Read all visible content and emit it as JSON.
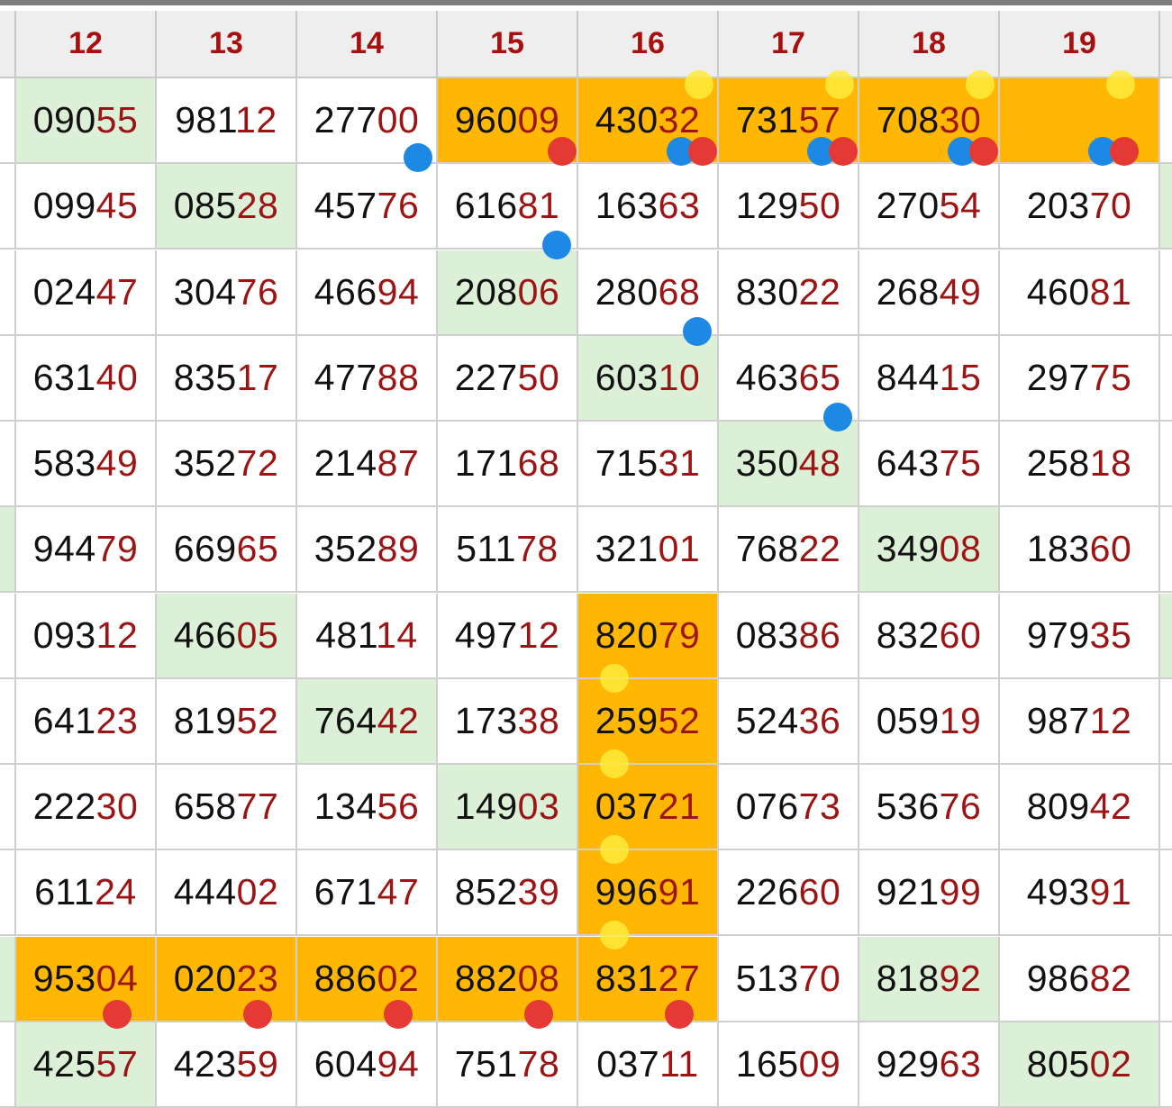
{
  "columns": [
    "12",
    "13",
    "14",
    "15",
    "16",
    "17",
    "18",
    "19"
  ],
  "rows": [
    {
      "cells": [
        [
          "090",
          "55",
          "green"
        ],
        [
          "981",
          "12",
          ""
        ],
        [
          "277",
          "00",
          ""
        ],
        [
          "960",
          "09",
          "orange"
        ],
        [
          "430",
          "32",
          "orange"
        ],
        [
          "731",
          "57",
          "orange"
        ],
        [
          "708",
          "30",
          "orange"
        ],
        [
          "",
          "",
          "orange"
        ]
      ]
    },
    {
      "cells": [
        [
          "099",
          "45",
          ""
        ],
        [
          "085",
          "28",
          "green"
        ],
        [
          "457",
          "76",
          ""
        ],
        [
          "616",
          "81",
          ""
        ],
        [
          "163",
          "63",
          ""
        ],
        [
          "129",
          "50",
          ""
        ],
        [
          "270",
          "54",
          ""
        ],
        [
          "203",
          "70",
          ""
        ]
      ]
    },
    {
      "cells": [
        [
          "024",
          "47",
          ""
        ],
        [
          "304",
          "76",
          ""
        ],
        [
          "466",
          "94",
          ""
        ],
        [
          "208",
          "06",
          "green"
        ],
        [
          "280",
          "68",
          ""
        ],
        [
          "830",
          "22",
          ""
        ],
        [
          "268",
          "49",
          ""
        ],
        [
          "460",
          "81",
          ""
        ]
      ]
    },
    {
      "cells": [
        [
          "631",
          "40",
          ""
        ],
        [
          "835",
          "17",
          ""
        ],
        [
          "477",
          "88",
          ""
        ],
        [
          "227",
          "50",
          ""
        ],
        [
          "603",
          "10",
          "green"
        ],
        [
          "463",
          "65",
          ""
        ],
        [
          "844",
          "15",
          ""
        ],
        [
          "297",
          "75",
          ""
        ]
      ]
    },
    {
      "cells": [
        [
          "583",
          "49",
          ""
        ],
        [
          "352",
          "72",
          ""
        ],
        [
          "214",
          "87",
          ""
        ],
        [
          "171",
          "68",
          ""
        ],
        [
          "715",
          "31",
          ""
        ],
        [
          "350",
          "48",
          "green"
        ],
        [
          "643",
          "75",
          ""
        ],
        [
          "258",
          "18",
          ""
        ]
      ]
    },
    {
      "cells": [
        [
          "944",
          "79",
          ""
        ],
        [
          "669",
          "65",
          ""
        ],
        [
          "352",
          "89",
          ""
        ],
        [
          "511",
          "78",
          ""
        ],
        [
          "321",
          "01",
          ""
        ],
        [
          "768",
          "22",
          ""
        ],
        [
          "349",
          "08",
          "green"
        ],
        [
          "183",
          "60",
          ""
        ]
      ]
    },
    {
      "cells": [
        [
          "093",
          "12",
          ""
        ],
        [
          "466",
          "05",
          "green"
        ],
        [
          "481",
          "14",
          ""
        ],
        [
          "497",
          "12",
          ""
        ],
        [
          "820",
          "79",
          "orange"
        ],
        [
          "083",
          "86",
          ""
        ],
        [
          "832",
          "60",
          ""
        ],
        [
          "979",
          "35",
          ""
        ]
      ]
    },
    {
      "cells": [
        [
          "641",
          "23",
          ""
        ],
        [
          "819",
          "52",
          ""
        ],
        [
          "764",
          "42",
          "green"
        ],
        [
          "173",
          "38",
          ""
        ],
        [
          "259",
          "52",
          "orange"
        ],
        [
          "524",
          "36",
          ""
        ],
        [
          "059",
          "19",
          ""
        ],
        [
          "987",
          "12",
          ""
        ]
      ]
    },
    {
      "cells": [
        [
          "222",
          "30",
          ""
        ],
        [
          "658",
          "77",
          ""
        ],
        [
          "134",
          "56",
          ""
        ],
        [
          "149",
          "03",
          "green"
        ],
        [
          "037",
          "21",
          "orange"
        ],
        [
          "076",
          "73",
          ""
        ],
        [
          "536",
          "76",
          ""
        ],
        [
          "809",
          "42",
          ""
        ]
      ]
    },
    {
      "cells": [
        [
          "611",
          "24",
          ""
        ],
        [
          "444",
          "02",
          ""
        ],
        [
          "671",
          "47",
          ""
        ],
        [
          "852",
          "39",
          ""
        ],
        [
          "996",
          "91",
          "orange"
        ],
        [
          "226",
          "60",
          ""
        ],
        [
          "921",
          "99",
          ""
        ],
        [
          "493",
          "91",
          ""
        ]
      ]
    },
    {
      "cells": [
        [
          "953",
          "04",
          "orange"
        ],
        [
          "020",
          "23",
          "orange"
        ],
        [
          "886",
          "02",
          "orange"
        ],
        [
          "882",
          "08",
          "orange"
        ],
        [
          "831",
          "27",
          "orange"
        ],
        [
          "513",
          "70",
          ""
        ],
        [
          "818",
          "92",
          "green"
        ],
        [
          "986",
          "82",
          ""
        ]
      ]
    },
    {
      "cells": [
        [
          "425",
          "57",
          "green"
        ],
        [
          "423",
          "59",
          ""
        ],
        [
          "604",
          "94",
          ""
        ],
        [
          "751",
          "78",
          ""
        ],
        [
          "037",
          "11",
          ""
        ],
        [
          "165",
          "09",
          ""
        ],
        [
          "929",
          "63",
          ""
        ],
        [
          "805",
          "02",
          "green"
        ]
      ]
    }
  ],
  "left_strip": [
    "",
    "",
    "",
    "",
    "",
    "green",
    "",
    "",
    "",
    "",
    "green",
    ""
  ],
  "right_strip": [
    "",
    "green",
    "",
    "",
    "",
    "",
    "green",
    "",
    "",
    "",
    "",
    ""
  ],
  "colors": {
    "orange": "#ffb703",
    "green": "#dcefd7",
    "header_text": "#a80f0f",
    "tail_text": "#9c1414",
    "blue_marker": "#1e88e5",
    "red_marker": "#e53935",
    "yellow_marker": "#ffeb3b"
  },
  "markers": [
    {
      "type": "yellow",
      "row": 0,
      "col": 4
    },
    {
      "type": "yellow",
      "row": 0,
      "col": 5
    },
    {
      "type": "yellow",
      "row": 0,
      "col": 6
    },
    {
      "type": "yellow",
      "row": 0,
      "col": 7
    },
    {
      "type": "blue",
      "row": 0,
      "col": 2
    },
    {
      "type": "red",
      "row": 0,
      "col": 3
    },
    {
      "type": "blue",
      "row": 0,
      "col": 4
    },
    {
      "type": "red",
      "row": 0,
      "col": 4
    },
    {
      "type": "blue",
      "row": 0,
      "col": 5
    },
    {
      "type": "red",
      "row": 0,
      "col": 5
    },
    {
      "type": "blue",
      "row": 0,
      "col": 6
    },
    {
      "type": "red",
      "row": 0,
      "col": 6
    },
    {
      "type": "blue",
      "row": 0,
      "col": 7
    },
    {
      "type": "red",
      "row": 0,
      "col": 7
    },
    {
      "type": "blue",
      "row": 1,
      "col": 3
    },
    {
      "type": "blue",
      "row": 2,
      "col": 4
    },
    {
      "type": "blue",
      "row": 3,
      "col": 5
    },
    {
      "type": "yellow",
      "row": 6,
      "col": 4
    },
    {
      "type": "yellow",
      "row": 7,
      "col": 4
    },
    {
      "type": "yellow",
      "row": 8,
      "col": 4
    },
    {
      "type": "yellow",
      "row": 9,
      "col": 4
    },
    {
      "type": "red",
      "row": 10,
      "col": 0
    },
    {
      "type": "red",
      "row": 10,
      "col": 1
    },
    {
      "type": "red",
      "row": 10,
      "col": 2
    },
    {
      "type": "red",
      "row": 10,
      "col": 3
    },
    {
      "type": "red",
      "row": 10,
      "col": 4
    }
  ]
}
